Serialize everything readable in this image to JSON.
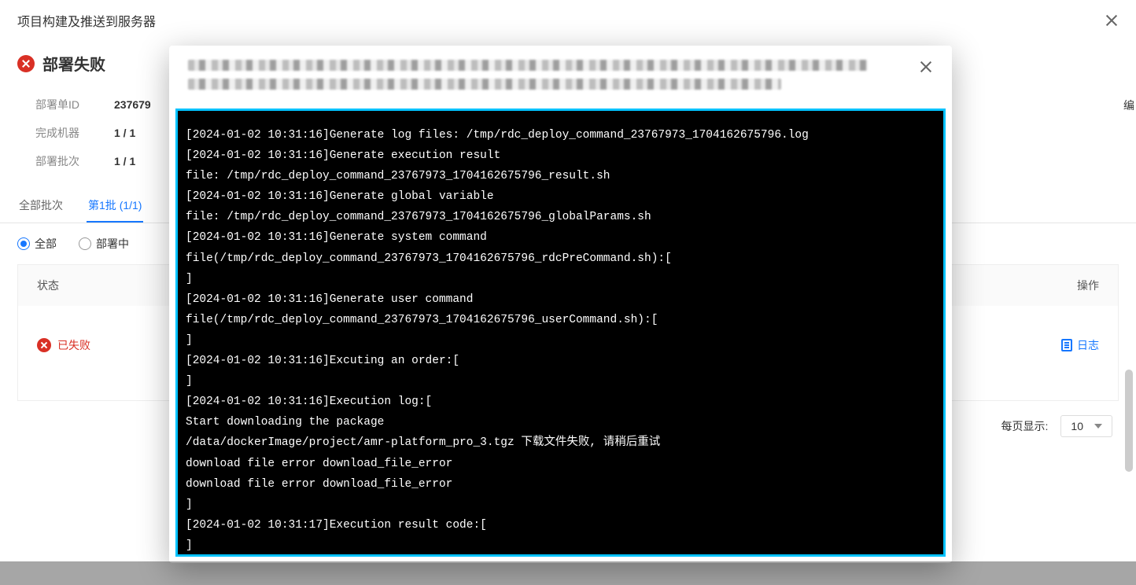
{
  "outer": {
    "title": "项目构建及推送到服务器",
    "status_text": "部署失败",
    "info": {
      "deploy_id_label": "部署单ID",
      "deploy_id_value": "237679",
      "machines_label": "完成机器",
      "machines_value": "1 / 1",
      "batches_label": "部署批次",
      "batches_value": "1 / 1"
    },
    "tabs": {
      "all": "全部批次",
      "first_prefix": "第1批",
      "first_count": "(1/1)"
    },
    "filters": {
      "all": "全部",
      "deploying": "部署中"
    },
    "table": {
      "header_status": "状态",
      "header_ops": "操作",
      "row_status": "已失败",
      "row_log_link": "日志"
    },
    "pager": {
      "per_page_label": "每页显示:",
      "page_size": "10"
    },
    "side_fragment": "编"
  },
  "log_dialog": {
    "terminal_text": "[2024-01-02 10:31:16]Generate log files: /tmp/rdc_deploy_command_23767973_1704162675796.log\n[2024-01-02 10:31:16]Generate execution result\nfile: /tmp/rdc_deploy_command_23767973_1704162675796_result.sh\n[2024-01-02 10:31:16]Generate global variable\nfile: /tmp/rdc_deploy_command_23767973_1704162675796_globalParams.sh\n[2024-01-02 10:31:16]Generate system command\nfile(/tmp/rdc_deploy_command_23767973_1704162675796_rdcPreCommand.sh):[\n]\n[2024-01-02 10:31:16]Generate user command\nfile(/tmp/rdc_deploy_command_23767973_1704162675796_userCommand.sh):[\n]\n[2024-01-02 10:31:16]Excuting an order:[\n]\n[2024-01-02 10:31:16]Execution log:[\nStart downloading the package\n/data/dockerImage/project/amr-platform_pro_3.tgz 下载文件失败, 请稍后重试\ndownload file error download_file_error\ndownload file error download_file_error\n]\n[2024-01-02 10:31:17]Execution result code:[\n]"
  }
}
